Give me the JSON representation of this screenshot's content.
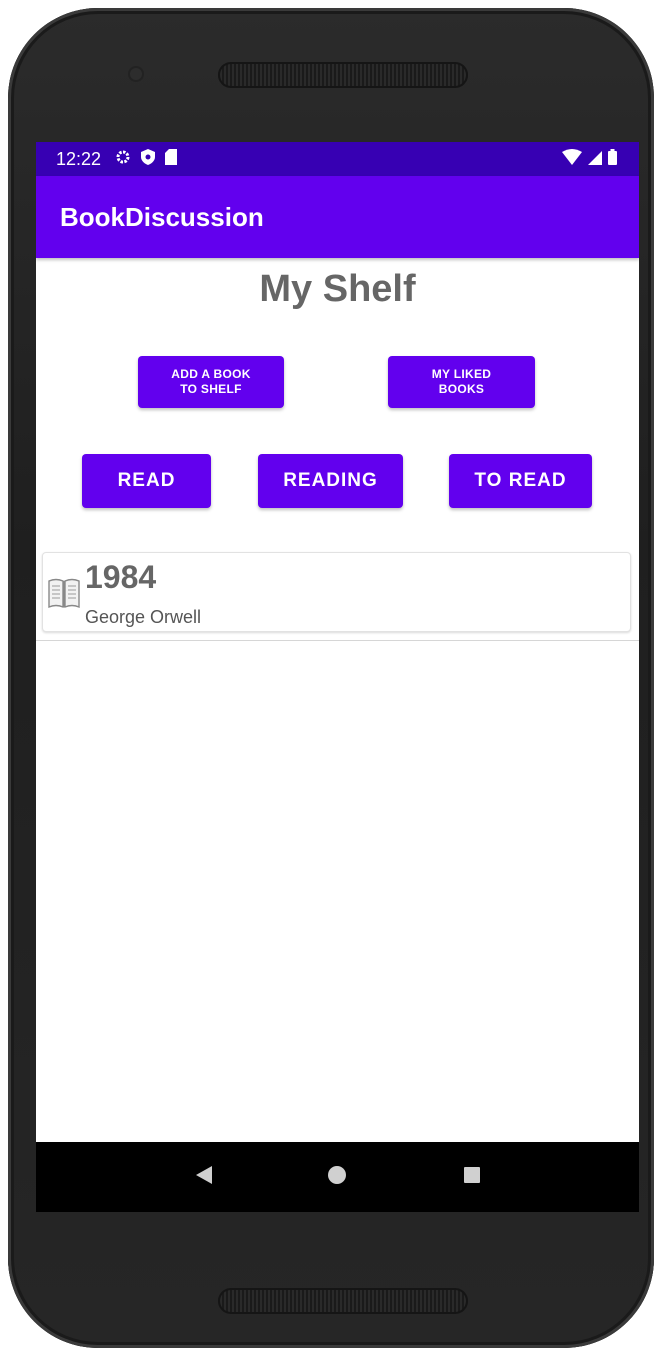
{
  "status_bar": {
    "time": "12:22",
    "icons": [
      "gear-icon",
      "shield-icon",
      "sd-card-icon",
      "wifi-icon",
      "signal-icon",
      "battery-icon"
    ]
  },
  "app_bar": {
    "title": "BookDiscussion"
  },
  "page": {
    "title": "My Shelf"
  },
  "actions": {
    "add_book_label": "ADD A BOOK\nTO SHELF",
    "liked_books_label": "MY LIKED\nBOOKS"
  },
  "filters": {
    "read_label": "READ",
    "reading_label": "READING",
    "to_read_label": "TO READ"
  },
  "books": [
    {
      "title": "1984",
      "author": "George Orwell",
      "icon": "book-icon"
    }
  ],
  "nav_bar": {
    "icons": [
      "back-icon",
      "home-icon",
      "recents-icon"
    ]
  },
  "colors": {
    "primary": "#6200ee",
    "status_bar": "#3700b3",
    "title_text": "#666666"
  }
}
